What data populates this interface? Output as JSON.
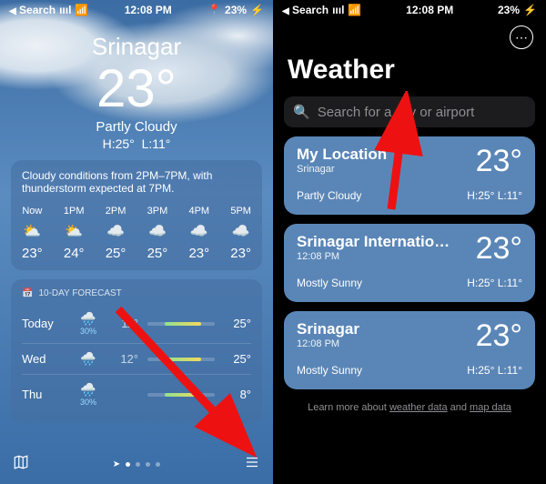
{
  "status": {
    "search": "Search",
    "signal": "ıııl",
    "wifi": "📶",
    "time": "12:08 PM",
    "loc": "📍",
    "battery_pct": "23%",
    "charging": "⚡"
  },
  "left": {
    "city": "Srinagar",
    "temp": "23°",
    "cond": "Partly Cloudy",
    "hi": "H:25°",
    "lo": "L:11°",
    "summary": "Cloudy conditions from 2PM–7PM, with thunderstorm expected at 7PM.",
    "hourly": [
      {
        "t": "Now",
        "ic": "⛅",
        "temp": "23°"
      },
      {
        "t": "1PM",
        "ic": "⛅",
        "temp": "24°"
      },
      {
        "t": "2PM",
        "ic": "☁️",
        "temp": "25°"
      },
      {
        "t": "3PM",
        "ic": "☁️",
        "temp": "25°"
      },
      {
        "t": "4PM",
        "ic": "☁️",
        "temp": "23°"
      },
      {
        "t": "5PM",
        "ic": "☁️",
        "temp": "23°"
      }
    ],
    "forecast_title": "10-DAY FORECAST",
    "forecast": [
      {
        "day": "Today",
        "ic": "🌧️",
        "pct": "30%",
        "lo": "11°",
        "hi": "25°"
      },
      {
        "day": "Wed",
        "ic": "🌧️",
        "pct": "",
        "lo": "12°",
        "hi": "25°"
      },
      {
        "day": "Thu",
        "ic": "🌧️",
        "pct": "30%",
        "lo": "",
        "hi": "8°"
      }
    ]
  },
  "right": {
    "title": "Weather",
    "search_placeholder": "Search for a city or airport",
    "cards": [
      {
        "name": "My Location",
        "sub": "Srinagar",
        "temp": "23°",
        "cond": "Partly Cloudy",
        "hl": "H:25°  L:11°"
      },
      {
        "name": "Srinagar Internatio…",
        "sub": "12:08 PM",
        "temp": "23°",
        "cond": "Mostly Sunny",
        "hl": "H:25°  L:11°"
      },
      {
        "name": "Srinagar",
        "sub": "12:08 PM",
        "temp": "23°",
        "cond": "Mostly Sunny",
        "hl": "H:25°  L:11°"
      }
    ],
    "learn_pre": "Learn more about ",
    "learn_a": "weather data",
    "learn_mid": " and ",
    "learn_b": "map data"
  }
}
